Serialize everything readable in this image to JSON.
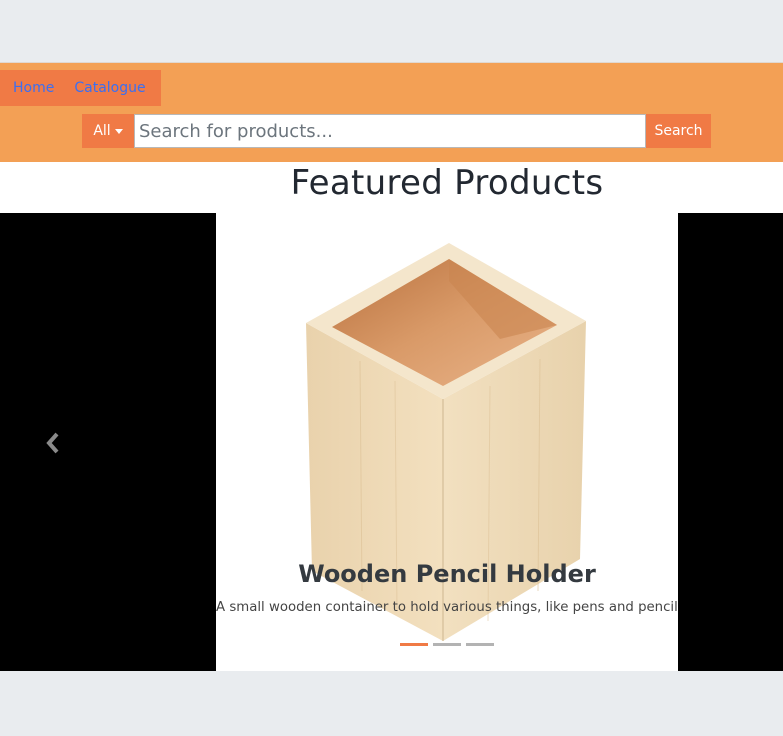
{
  "nav": {
    "home_label": "Home",
    "catalogue_label": "Catalogue"
  },
  "search": {
    "category_label": "All",
    "placeholder": "Search for products...",
    "button_label": "Search"
  },
  "featured": {
    "title": "Featured Products"
  },
  "carousel": {
    "active_index": 0,
    "slide_count": 3,
    "slide": {
      "title": "Wooden Pencil Holder",
      "description": "A small wooden container to hold various things, like pens and pencils."
    }
  },
  "icons": {
    "prev": "chevron-left-icon",
    "dropdown": "caret-down-icon"
  },
  "colors": {
    "header_bg": "#f3a055",
    "accent": "#f07a45",
    "link": "#3b6ff2",
    "carousel_bg": "#000000"
  }
}
